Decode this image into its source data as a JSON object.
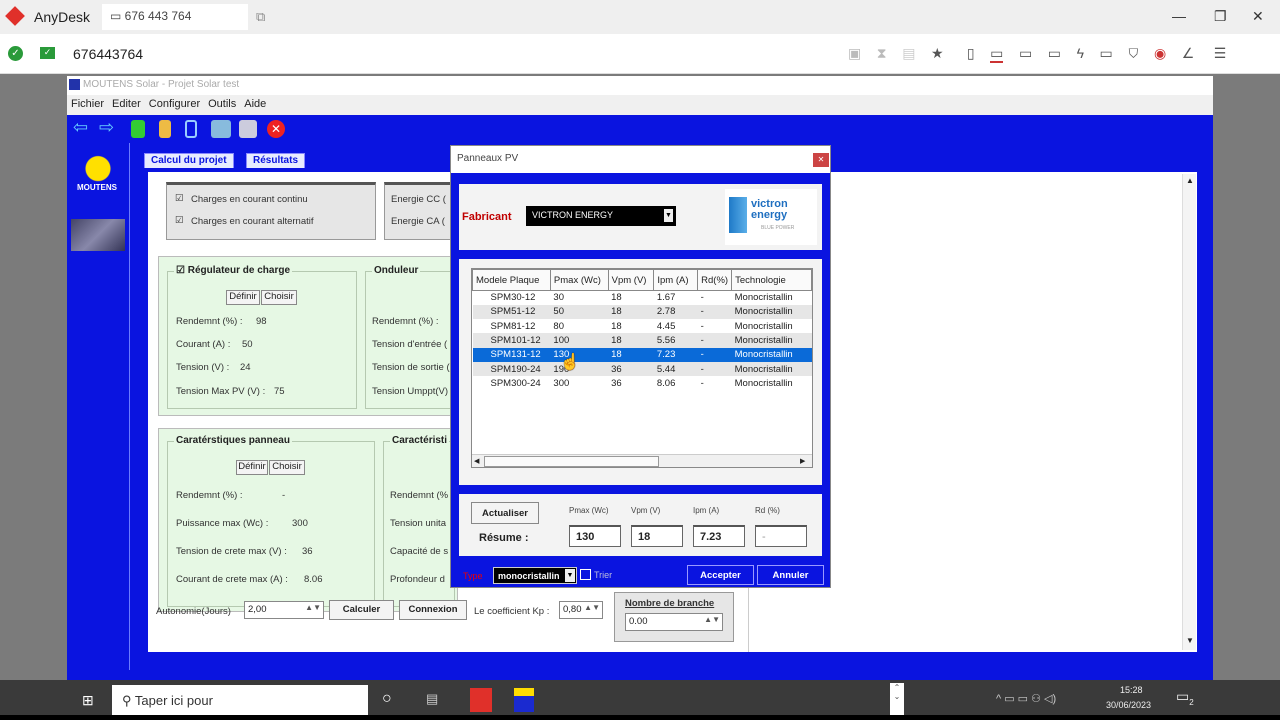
{
  "anydesk": {
    "brand": "AnyDesk",
    "tab_label": "676 443 764",
    "address": "676443764",
    "toolbar_icons": [
      "screenshot-icon",
      "hourglass-icon",
      "clipboard-icon",
      "star-icon",
      "file-transfer-icon",
      "display-icon",
      "monitor-icon",
      "chat-icon",
      "lightning-icon",
      "keyboard-icon",
      "shield-icon",
      "record-icon",
      "draw-icon",
      "menu-icon"
    ]
  },
  "app": {
    "title": "MOUTENS Solar - Projet Solar test",
    "menu": [
      "Fichier",
      "Editer",
      "Configurer",
      "Outils",
      "Aide"
    ],
    "sidebar_logo": "MOUTENS",
    "tabs": [
      "Calcul du projet",
      "Résultats"
    ],
    "charges": {
      "dc": "Charges en courant continu",
      "ac": "Charges en courant alternatif",
      "energy_dc": "Energie CC (",
      "energy_ac": "Energie CA ("
    },
    "regulateur": {
      "title": "Régulateur de charge",
      "define": "Définir",
      "choose": "Choisir",
      "rendement": "Rendemnt (%) :",
      "rendement_val": "98",
      "courant": "Courant (A) :",
      "courant_val": "50",
      "tension": "Tension (V) :",
      "tension_val": "24",
      "tension_max": "Tension Max PV (V) :",
      "tension_max_val": "75"
    },
    "onduleur": {
      "title": "Onduleur",
      "rendement": "Rendemnt (%) :",
      "tension_entree": "Tension d'entrée (",
      "tension_sortie": "Tension de sortie (",
      "tension_umppt": "Tension Umppt(V)"
    },
    "panneau": {
      "title": "Caratérstiques panneau",
      "define": "Définir",
      "choose": "Choisir",
      "rendement": "Rendemnt (%) :",
      "rendement_val": "-",
      "puissance": "Puissance max (Wc) :",
      "puissance_val": "300",
      "tension": "Tension de crete max (V) :",
      "tension_val": "36",
      "courant": "Courant de crete max (A) :",
      "courant_val": "8.06"
    },
    "batterie": {
      "title": "Caractéristi",
      "rendement": "Rendemnt (%",
      "tension": "Tension unita",
      "capacite": "Capacité de s",
      "profondeur": "Profondeur d"
    },
    "bottom": {
      "autonomie_label": "Autonomie(Jours)",
      "autonomie_val": "2,00",
      "calculer": "Calculer",
      "connexion": "Connexion",
      "kp_label": "Le coefficient Kp :",
      "kp_val": "0,80",
      "branche_label": "Nombre de branche",
      "branche_val": "0.00"
    }
  },
  "dialog": {
    "title": "Panneaux PV",
    "fabricant_label": "Fabricant",
    "fabricant_value": "VICTRON ENERGY",
    "logo_text": "victron energy",
    "logo_sub": "BLUE POWER",
    "columns": [
      "Modele Plaque",
      "Pmax (Wc)",
      "Vpm (V)",
      "Ipm (A)",
      "Rd(%)",
      "Technologie"
    ],
    "rows": [
      [
        "SPM30-12",
        "30",
        "18",
        "1.67",
        "-",
        "Monocristallin"
      ],
      [
        "SPM51-12",
        "50",
        "18",
        "2.78",
        "-",
        "Monocristallin"
      ],
      [
        "SPM81-12",
        "80",
        "18",
        "4.45",
        "-",
        "Monocristallin"
      ],
      [
        "SPM101-12",
        "100",
        "18",
        "5.56",
        "-",
        "Monocristallin"
      ],
      [
        "SPM131-12",
        "130",
        "18",
        "7.23",
        "-",
        "Monocristallin"
      ],
      [
        "SPM190-24",
        "190",
        "36",
        "5.44",
        "-",
        "Monocristallin"
      ],
      [
        "SPM300-24",
        "300",
        "36",
        "8.06",
        "-",
        "Monocristallin"
      ]
    ],
    "selected_row": 4,
    "actualiser": "Actualiser",
    "resume": "Résume :",
    "sum_labels": [
      "Pmax (Wc)",
      "Vpm (V)",
      "Ipm (A)",
      "Rd (%)"
    ],
    "sum_values": [
      "130",
      "18",
      "7.23",
      "-"
    ],
    "type_label": "Type",
    "type_value": "monocristallin",
    "trier": "Trier",
    "accepter": "Accepter",
    "annuler": "Annuler"
  },
  "taskbar": {
    "search_placeholder": "Taper ici pour",
    "time": "15:28",
    "date": "30/06/2023",
    "notif_count": "2"
  },
  "colors": {
    "app_blue": "#0a14e0",
    "selected": "#0a6ad8",
    "panel_green": "#e6f8e4",
    "fabricant_red": "#c00000"
  }
}
